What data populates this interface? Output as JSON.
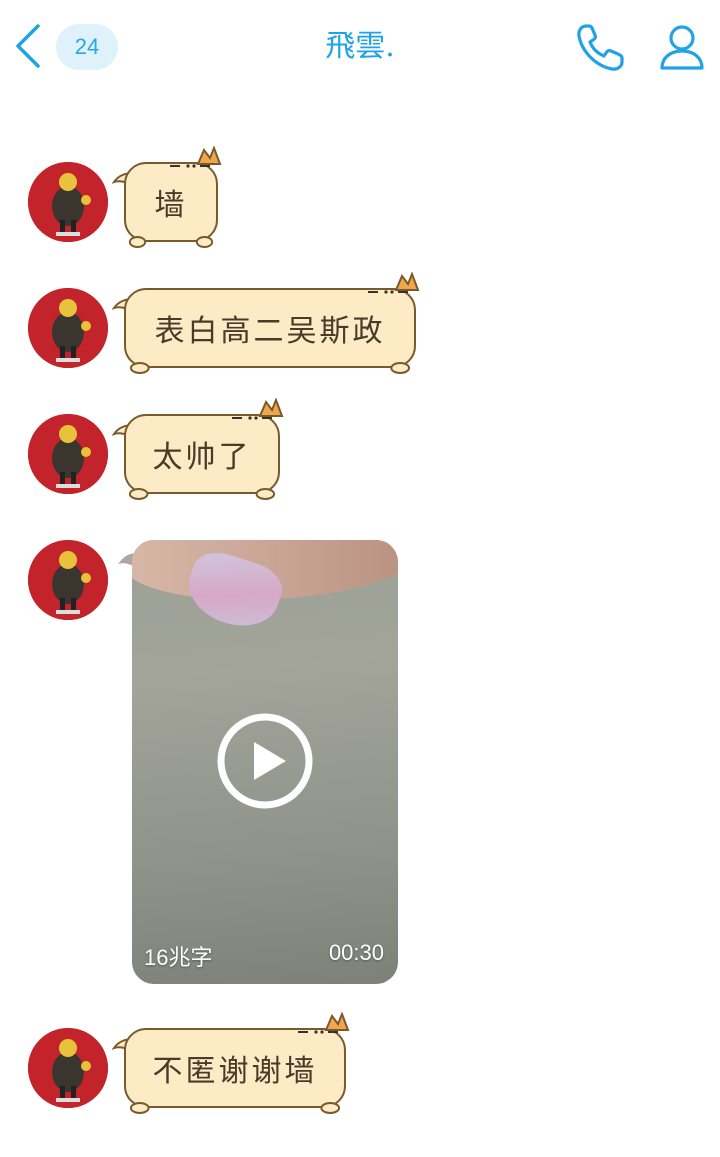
{
  "header": {
    "unread_count": "24",
    "title": "飛雲."
  },
  "messages": [
    {
      "type": "text",
      "text": "墙"
    },
    {
      "type": "text",
      "text": "表白高二吴斯政"
    },
    {
      "type": "text",
      "text": "太帅了"
    },
    {
      "type": "video",
      "size_label": "16兆字",
      "duration": "00:30"
    },
    {
      "type": "text",
      "text": "不匿谢谢墙"
    }
  ],
  "colors": {
    "accent": "#1fa3e6",
    "badge_bg": "#dff1fb",
    "bubble_fill": "#fcebc4",
    "bubble_border": "#7a5a2c",
    "avatar_bg": "#c3232a"
  }
}
